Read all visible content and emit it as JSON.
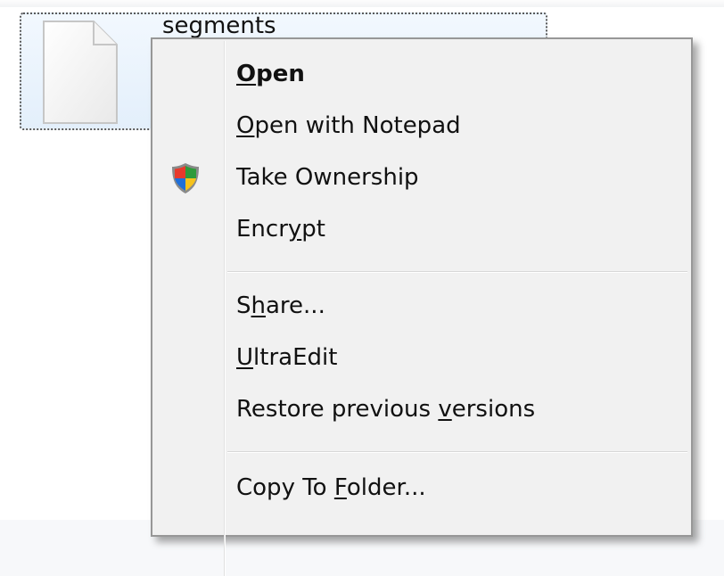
{
  "file": {
    "name": "segments"
  },
  "menu": {
    "items": [
      {
        "pre": "",
        "key": "O",
        "post": "pen",
        "bold": true
      },
      {
        "pre": "",
        "key": "O",
        "post": "pen with Notepad"
      },
      {
        "pre": "",
        "key": "",
        "post": "Take Ownership",
        "icon": "uac-shield-icon"
      },
      {
        "pre": "Encr",
        "key": "y",
        "post": "pt"
      },
      {
        "pre": "S",
        "key": "h",
        "post": "are..."
      },
      {
        "pre": "",
        "key": "U",
        "post": "ltraEdit"
      },
      {
        "pre": "Restore previous ",
        "key": "v",
        "post": "ersions"
      },
      {
        "pre": "Copy To ",
        "key": "F",
        "post": "older..."
      }
    ]
  }
}
